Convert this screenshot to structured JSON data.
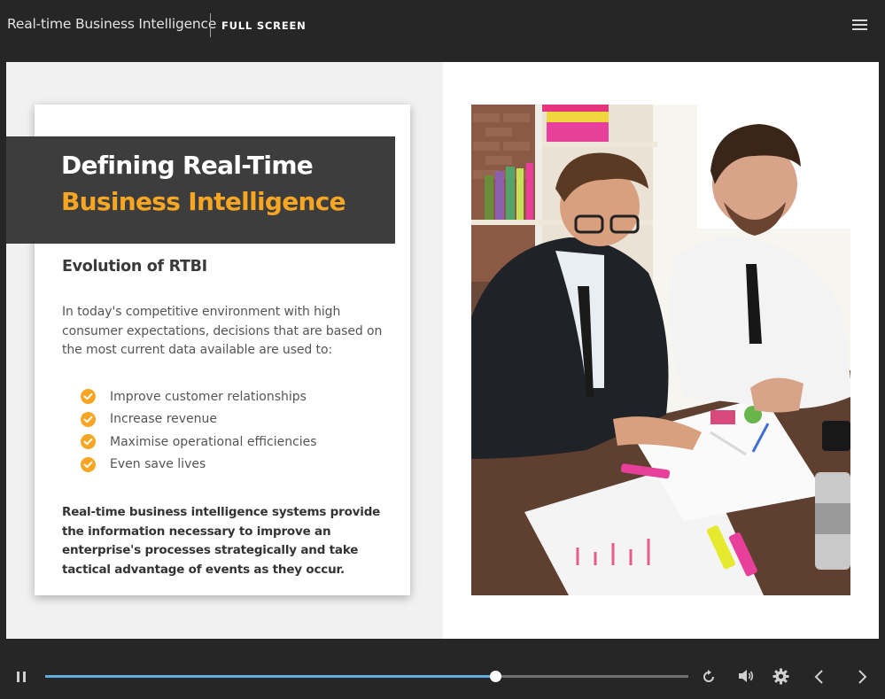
{
  "header": {
    "app_title": "Real-time Business Intelligence",
    "fullscreen_label": "FULL SCREEN",
    "menu_icon": "hamburger-menu-icon"
  },
  "slide": {
    "banner_line1": "Defining Real-Time",
    "banner_line2": "Business Intelligence",
    "subheading": "Evolution of RTBI",
    "intro": "In today's competitive environment with high consumer expectations, decisions that are based on the most current data available are used to:",
    "bullets": [
      "Improve customer relationships",
      "Increase revenue",
      "Maximise operational efficiencies",
      "Even save lives"
    ],
    "closing": "Real-time business intelligence systems provide the information necessary to improve an enterprise's processes strategically and take tactical advantage of events as they occur.",
    "bullet_icon": "check-circle-icon",
    "accent_color": "#f6a623",
    "banner_color": "#3d3d3d"
  },
  "player": {
    "progress": 0.7,
    "progress_color": "#5dafdf",
    "icons": [
      "pause-icon",
      "replay-icon",
      "volume-icon",
      "settings-icon",
      "previous-icon",
      "next-icon"
    ]
  }
}
